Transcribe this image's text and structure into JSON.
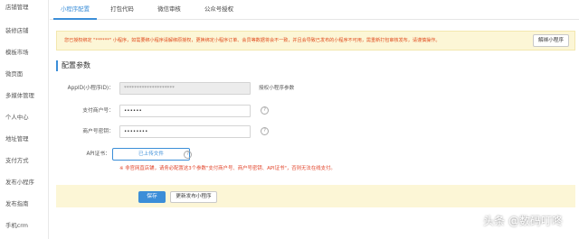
{
  "sidebar": {
    "items": [
      {
        "label": "店铺管理"
      },
      {
        "label": "装修店铺"
      },
      {
        "label": "模板市场"
      },
      {
        "label": "微页面"
      },
      {
        "label": "多媒体管理"
      },
      {
        "label": "个人中心"
      },
      {
        "label": "地址管理"
      },
      {
        "label": "支付方式"
      },
      {
        "label": "发布小程序"
      },
      {
        "label": "发布指南"
      },
      {
        "label": "手机crm"
      }
    ]
  },
  "tabs": [
    {
      "label": "小程序配置"
    },
    {
      "label": "打包代码"
    },
    {
      "label": "微信审核"
    },
    {
      "label": "公众号授权"
    }
  ],
  "notice": {
    "text": "您已授权绑定 \"******\" 小程序，如需要绑小程序请解绑原授权，更换绑定小程序订单、会员等数据将会不一致，并且会导致已发布的小程序不可用，需重新打包审核发布，请谨慎操作。",
    "button": "解绑小程序"
  },
  "section": {
    "title": "配置参数"
  },
  "form": {
    "appid": {
      "label": "AppID(小程序ID)：",
      "value": "********************",
      "hint": "授权小程序参数"
    },
    "merchant_id": {
      "label": "支付商户号：",
      "value": "••••••"
    },
    "merchant_key": {
      "label": "商户号密钥：",
      "value": "••••••••"
    },
    "api_cert": {
      "label": "API证书：",
      "button": "已上传文件"
    },
    "help_symbol": "?",
    "warning": "※ 非官网直店铺，请务必配置这3个参数\"支付商户号、商户号密钥、API证书\"，否则无法在线支付。"
  },
  "actions": {
    "save": "保存",
    "republish": "更新发布小程序"
  },
  "watermark": "头条 @数码叮咚",
  "colors": {
    "accent": "#3b8ed8",
    "notice_bg": "#fcf6d6",
    "warning_text": "#e2452b"
  }
}
